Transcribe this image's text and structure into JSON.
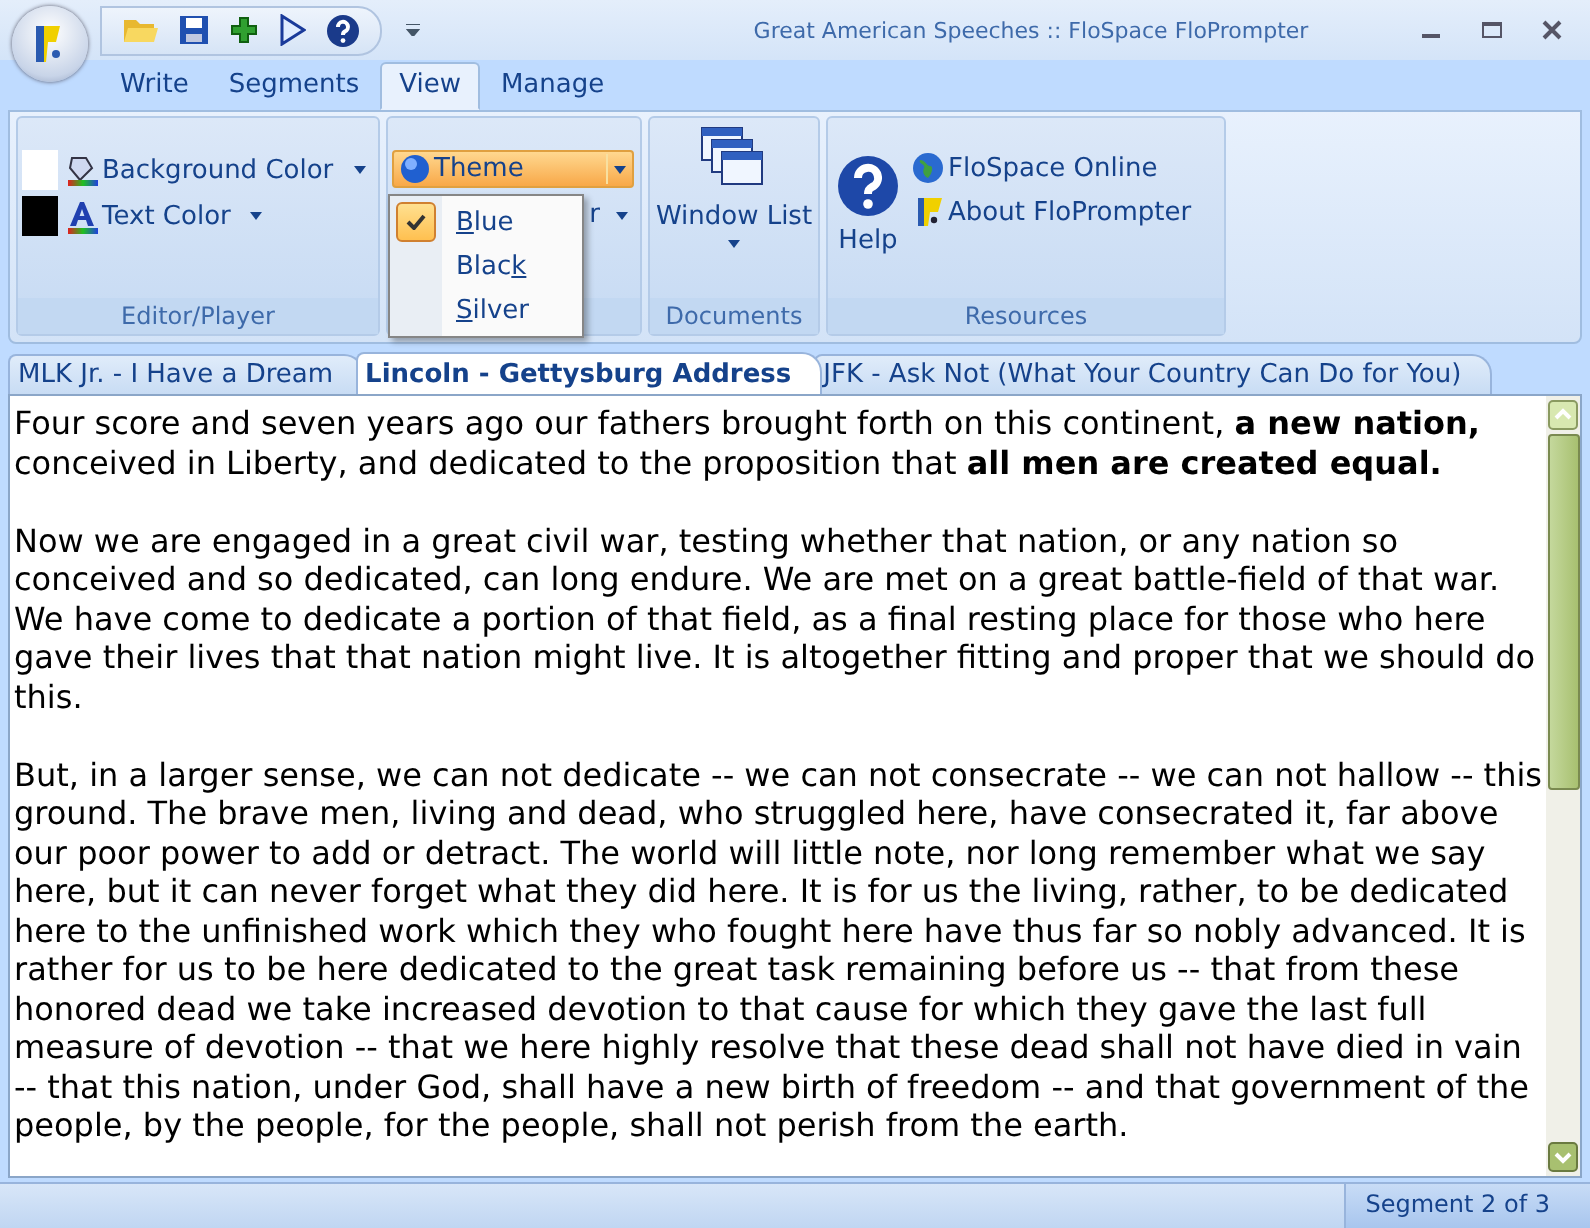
{
  "window": {
    "title": "Great American Speeches :: FloSpace FloPrompter"
  },
  "ribbon_tabs": [
    {
      "label": "Write",
      "selected": false
    },
    {
      "label": "Segments",
      "selected": false
    },
    {
      "label": "View",
      "selected": true
    },
    {
      "label": "Manage",
      "selected": false
    }
  ],
  "groups": {
    "editor_player": {
      "label": "Editor/Player",
      "background_color": {
        "label": "Background Color",
        "color": "#ffffff"
      },
      "text_color": {
        "label": "Text Color",
        "color": "#000000"
      }
    },
    "theme": {
      "button": "Theme",
      "hidden_button_fragment": "r"
    },
    "documents": {
      "label": "Documents",
      "window_list": "Window List"
    },
    "resources": {
      "label": "Resources",
      "help": "Help",
      "online": "FloSpace Online",
      "about": "About FloPrompter"
    }
  },
  "theme_menu": [
    {
      "key": "B",
      "post": "lue",
      "checked": true
    },
    {
      "pre": "Blac",
      "key": "k",
      "checked": false
    },
    {
      "key": "S",
      "post": "ilver",
      "checked": false
    }
  ],
  "document_tabs": [
    {
      "label": "MLK Jr. - I Have a Dream",
      "selected": false
    },
    {
      "label": "Lincoln - Gettysburg Address",
      "selected": true
    },
    {
      "label": "JFK - Ask Not (What Your Country Can Do for You)",
      "selected": false
    }
  ],
  "paragraphs": [
    "Four score and seven years ago our fathers brought forth on this continent, **a new nation,** conceived in Liberty, and dedicated to the proposition that **all men are created equal.**",
    "Now we are engaged in a great civil war, testing whether that nation, or any nation so conceived and so dedicated, can long endure. We are met on a great battle-field of that war. We have come to dedicate a portion of that field, as a final resting place for those who here gave their lives that that nation might live. It is altogether fitting and proper that we should do this.",
    "But, in a larger sense, we can not dedicate -- we can not consecrate -- we can not hallow -- this ground. The brave men, living and dead, who struggled here, have consecrated it, far above our poor power to add or detract. The world will little note, nor long remember what we say here, but it can never forget what they did here. It is for us the living, rather, to be dedicated here to the unfinished work which they who fought here have thus far so nobly advanced. It is rather for us to be here dedicated to the great task remaining before us -- that from these honored dead we take increased devotion to that cause for which they gave the last full measure of devotion -- that we here highly resolve that these dead shall not have died in vain -- that this nation, under God, shall have a new birth of freedom -- and that government of the people, by the people, for the people, shall not perish from the earth."
  ],
  "status_bar": {
    "segment": "Segment 2 of 3"
  }
}
